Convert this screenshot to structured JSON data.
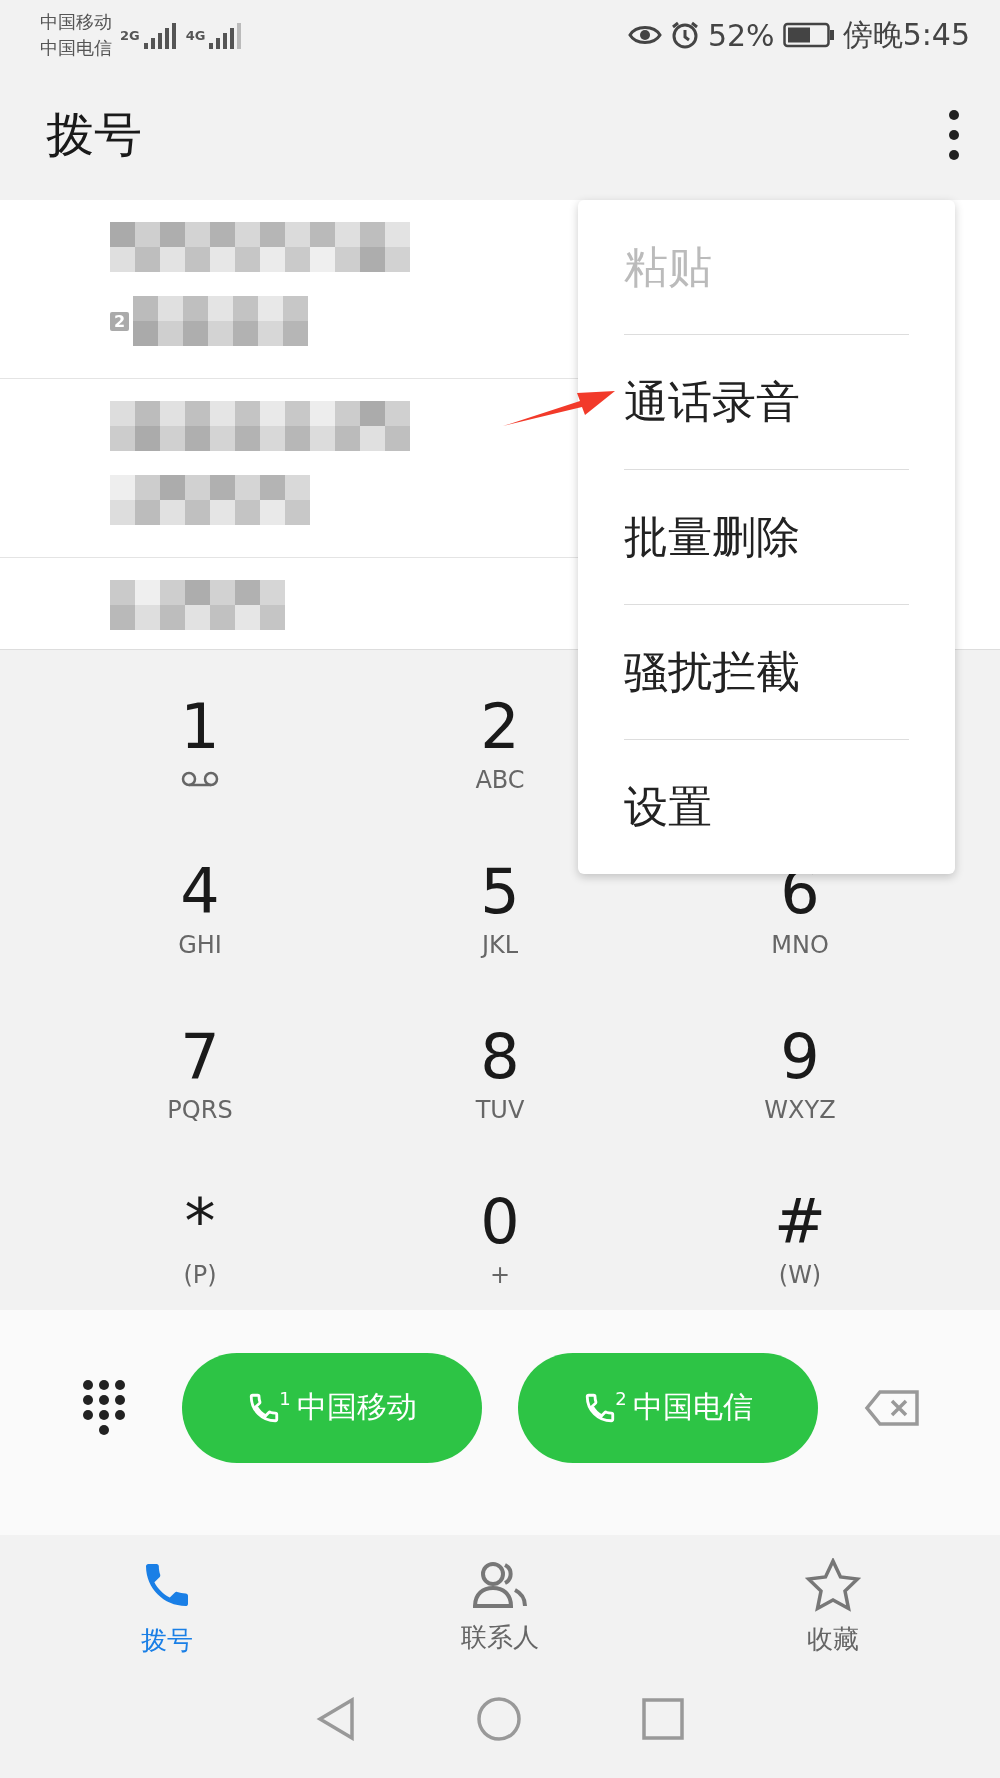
{
  "status_bar": {
    "carriers": [
      {
        "name": "中国移动",
        "network": "2G"
      },
      {
        "name": "中国电信",
        "network": "4G"
      }
    ],
    "battery_text": "52%",
    "time": "傍晚5:45"
  },
  "header": {
    "title": "拨号"
  },
  "call_log": {
    "rows": [
      {
        "sim_badge": "2"
      },
      {},
      {}
    ]
  },
  "menu": {
    "items": [
      {
        "label": "粘贴",
        "disabled": true
      },
      {
        "label": "通话录音",
        "disabled": false
      },
      {
        "label": "批量删除",
        "disabled": false
      },
      {
        "label": "骚扰拦截",
        "disabled": false
      },
      {
        "label": "设置",
        "disabled": false
      }
    ]
  },
  "keypad": [
    {
      "digit": "1",
      "kind": "voicemail"
    },
    {
      "digit": "2",
      "letters": "ABC",
      "kind": "letters"
    },
    {
      "kind": "hidden"
    },
    {
      "digit": "4",
      "letters": "GHI",
      "kind": "letters"
    },
    {
      "digit": "5",
      "letters": "JKL",
      "kind": "letters"
    },
    {
      "digit": "6",
      "letters": "MNO",
      "kind": "letters"
    },
    {
      "digit": "7",
      "letters": "PQRS",
      "kind": "letters"
    },
    {
      "digit": "8",
      "letters": "TUV",
      "kind": "letters"
    },
    {
      "digit": "9",
      "letters": "WXYZ",
      "kind": "letters"
    },
    {
      "digit": "*",
      "letters": "(P)",
      "kind": "letters"
    },
    {
      "digit": "0",
      "letters": "+",
      "kind": "letters"
    },
    {
      "digit": "#",
      "letters": "(W)",
      "kind": "letters"
    }
  ],
  "call_buttons": [
    {
      "sim": "1",
      "label": "中国移动"
    },
    {
      "sim": "2",
      "label": "中国电信"
    }
  ],
  "tabs": [
    {
      "label": "拨号",
      "kind": "phone",
      "selected": true
    },
    {
      "label": "联系人",
      "kind": "contacts",
      "selected": false
    },
    {
      "label": "收藏",
      "kind": "star",
      "selected": false
    }
  ]
}
